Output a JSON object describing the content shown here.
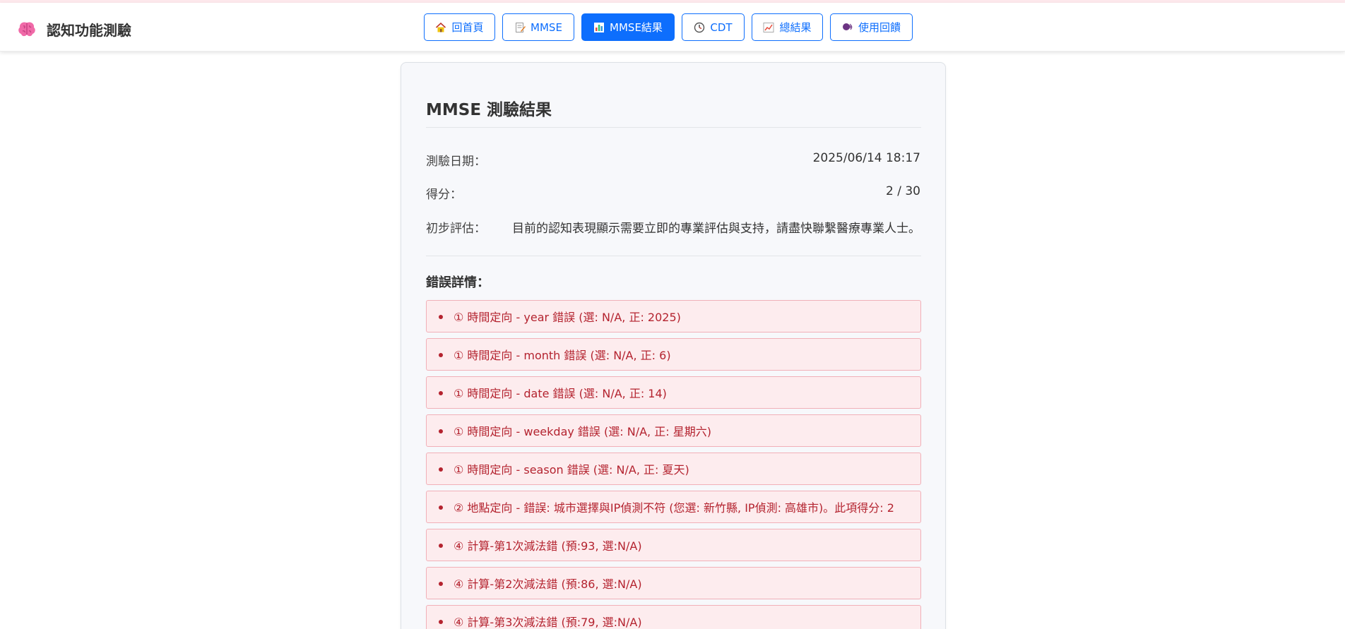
{
  "app": {
    "title": "認知功能測驗"
  },
  "nav": {
    "items": [
      {
        "label": "回首頁",
        "icon": "house-icon"
      },
      {
        "label": "MMSE",
        "icon": "memo-icon"
      },
      {
        "label": "MMSE結果",
        "icon": "bar-chart-icon",
        "active": true
      },
      {
        "label": "CDT",
        "icon": "clock-icon"
      },
      {
        "label": "總結果",
        "icon": "trend-chart-icon"
      },
      {
        "label": "使用回饋",
        "icon": "speech-icon"
      }
    ]
  },
  "result": {
    "title": "MMSE 測驗結果",
    "date_label": "測驗日期：",
    "date_value": "2025/06/14 18:17",
    "score_label": "得分：",
    "score_value": "2 / 30",
    "assessment_label": "初步評估：",
    "assessment_value": "目前的認知表現顯示需要立即的專業評估與支持，請盡快聯繫醫療專業人士。",
    "errors_title": "錯誤詳情：",
    "errors": [
      "① 時間定向 - year 錯誤 (選: N/A, 正: 2025)",
      "① 時間定向 - month 錯誤 (選: N/A, 正: 6)",
      "① 時間定向 - date 錯誤 (選: N/A, 正: 14)",
      "① 時間定向 - weekday 錯誤 (選: N/A, 正: 星期六)",
      "① 時間定向 - season 錯誤 (選: N/A, 正: 夏天)",
      "② 地點定向 - 錯誤: 城市選擇與IP偵測不符 (您選: 新竹縣, IP偵測: 高雄市)。此項得分: 2",
      "④ 計算-第1次減法錯 (預:93, 選:N/A)",
      "④ 計算-第2次減法錯 (預:86, 選:N/A)",
      "④ 計算-第3次減法錯 (預:79, 選:N/A)"
    ]
  },
  "colors": {
    "accent": "#0d6efd",
    "error_text": "#b4232f",
    "error_bg": "#fdecee",
    "error_border": "#f1b0b8"
  }
}
